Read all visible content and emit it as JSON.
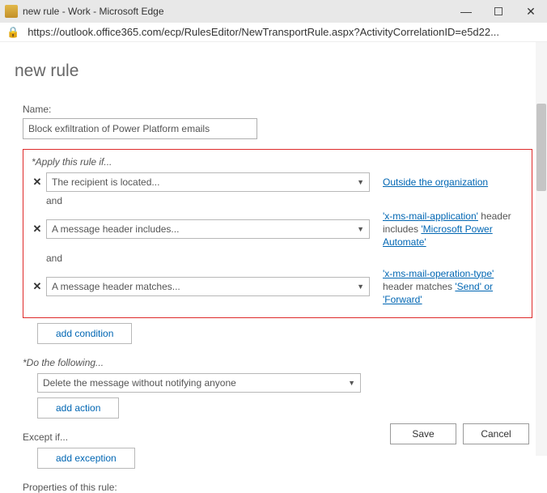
{
  "window": {
    "title": "new rule - Work - Microsoft Edge"
  },
  "address": {
    "url": "https://outlook.office365.com/ecp/RulesEditor/NewTransportRule.aspx?ActivityCorrelationID=e5d22..."
  },
  "page": {
    "heading": "new rule",
    "name_label": "Name:",
    "name_value": "Block exfiltration of Power Platform emails",
    "apply_if": "*Apply this rule if...",
    "and": "and",
    "conditions": [
      {
        "dropdown": "The recipient is located...",
        "side_link": "Outside the organization",
        "side_html": ""
      },
      {
        "dropdown": "A message header includes...",
        "side_prefix": "'x-ms-mail-application'",
        "side_mid": " header includes ",
        "side_link": "'Microsoft Power Automate'"
      },
      {
        "dropdown": "A message header matches...",
        "side_prefix": "'x-ms-mail-operation-type'",
        "side_mid": " header matches ",
        "side_link": "'Send' or 'Forward'"
      }
    ],
    "add_condition": "add condition",
    "do_following": "*Do the following...",
    "action_dropdown": "Delete the message without notifying anyone",
    "add_action": "add action",
    "except_if": "Except if...",
    "add_exception": "add exception",
    "properties": "Properties of this rule:",
    "save": "Save",
    "cancel": "Cancel"
  }
}
